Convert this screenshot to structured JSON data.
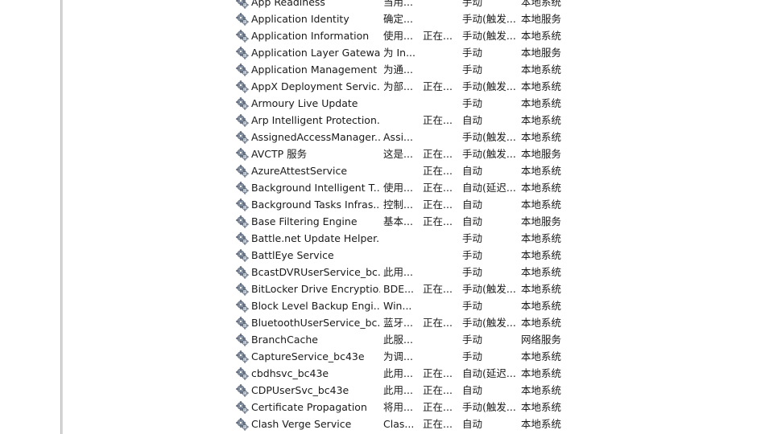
{
  "icons": {
    "service": "gear-icon"
  },
  "services": [
    {
      "name": "App Readiness",
      "description": "当用...",
      "status": "",
      "startup_type": "手动",
      "log_on_as": "本地系统"
    },
    {
      "name": "Application Identity",
      "description": "确定...",
      "status": "",
      "startup_type": "手动(触发...",
      "log_on_as": "本地服务"
    },
    {
      "name": "Application Information",
      "description": "使用...",
      "status": "正在...",
      "startup_type": "手动(触发...",
      "log_on_as": "本地系统"
    },
    {
      "name": "Application Layer Gatewa...",
      "description": "为 In...",
      "status": "",
      "startup_type": "手动",
      "log_on_as": "本地服务"
    },
    {
      "name": "Application Management",
      "description": "为通...",
      "status": "",
      "startup_type": "手动",
      "log_on_as": "本地系统"
    },
    {
      "name": "AppX Deployment Servic...",
      "description": "为部...",
      "status": "正在...",
      "startup_type": "手动(触发...",
      "log_on_as": "本地系统"
    },
    {
      "name": "Armoury Live Update",
      "description": "",
      "status": "",
      "startup_type": "手动",
      "log_on_as": "本地系统"
    },
    {
      "name": "Arp Intelligent Protection...",
      "description": "",
      "status": "正在...",
      "startup_type": "自动",
      "log_on_as": "本地系统"
    },
    {
      "name": "AssignedAccessManager...",
      "description": "Assi...",
      "status": "",
      "startup_type": "手动(触发...",
      "log_on_as": "本地系统"
    },
    {
      "name": "AVCTP 服务",
      "description": "这是...",
      "status": "正在...",
      "startup_type": "手动(触发...",
      "log_on_as": "本地服务"
    },
    {
      "name": "AzureAttestService",
      "description": "",
      "status": "正在...",
      "startup_type": "自动",
      "log_on_as": "本地系统"
    },
    {
      "name": "Background Intelligent T...",
      "description": "使用...",
      "status": "正在...",
      "startup_type": "自动(延迟...",
      "log_on_as": "本地系统"
    },
    {
      "name": "Background Tasks Infras...",
      "description": "控制...",
      "status": "正在...",
      "startup_type": "自动",
      "log_on_as": "本地系统"
    },
    {
      "name": "Base Filtering Engine",
      "description": "基本...",
      "status": "正在...",
      "startup_type": "自动",
      "log_on_as": "本地服务"
    },
    {
      "name": "Battle.net Update Helper...",
      "description": "",
      "status": "",
      "startup_type": "手动",
      "log_on_as": "本地系统"
    },
    {
      "name": "BattlEye Service",
      "description": "",
      "status": "",
      "startup_type": "手动",
      "log_on_as": "本地系统"
    },
    {
      "name": "BcastDVRUserService_bc...",
      "description": "此用...",
      "status": "",
      "startup_type": "手动",
      "log_on_as": "本地系统"
    },
    {
      "name": "BitLocker Drive Encryptio...",
      "description": "BDE...",
      "status": "正在...",
      "startup_type": "手动(触发...",
      "log_on_as": "本地系统"
    },
    {
      "name": "Block Level Backup Engi...",
      "description": "Win...",
      "status": "",
      "startup_type": "手动",
      "log_on_as": "本地系统"
    },
    {
      "name": "BluetoothUserService_bc...",
      "description": "蓝牙...",
      "status": "正在...",
      "startup_type": "手动(触发...",
      "log_on_as": "本地系统"
    },
    {
      "name": "BranchCache",
      "description": "此服...",
      "status": "",
      "startup_type": "手动",
      "log_on_as": "网络服务"
    },
    {
      "name": "CaptureService_bc43e",
      "description": "为调...",
      "status": "",
      "startup_type": "手动",
      "log_on_as": "本地系统"
    },
    {
      "name": "cbdhsvc_bc43e",
      "description": "此用...",
      "status": "正在...",
      "startup_type": "自动(延迟...",
      "log_on_as": "本地系统"
    },
    {
      "name": "CDPUserSvc_bc43e",
      "description": "此用...",
      "status": "正在...",
      "startup_type": "自动",
      "log_on_as": "本地系统"
    },
    {
      "name": "Certificate Propagation",
      "description": "将用...",
      "status": "正在...",
      "startup_type": "手动(触发...",
      "log_on_as": "本地系统"
    },
    {
      "name": "Clash Verge Service",
      "description": "Clas...",
      "status": "正在...",
      "startup_type": "自动",
      "log_on_as": "本地系统"
    }
  ]
}
